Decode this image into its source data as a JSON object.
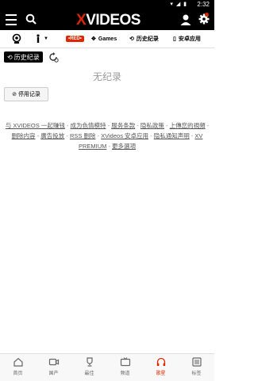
{
  "status": {
    "time": "2:32",
    "icons": "▾ ◢ ▮"
  },
  "header": {
    "logo_x": "X",
    "logo_rest": "VIDEOS"
  },
  "catbar": {
    "red_label": "•RED•",
    "games_label": "Games",
    "history_label": "历史纪录",
    "android_label": "安卓应用"
  },
  "main": {
    "history_button": "历史纪录",
    "empty_text": "无纪录",
    "disable_button": "停用记录"
  },
  "footer": {
    "links": [
      "与 XVIDEOS 一起赚钱",
      "成为色情模特",
      "服务条款",
      "隐私政策",
      "上傳您的視頻",
      "删除内容",
      "廣告投放",
      "RSS 删除",
      "XVideos 安卓应用",
      "隐私通知声明",
      "XV PREMIUM",
      "更多選項"
    ]
  },
  "tabs": [
    {
      "label": "首页"
    },
    {
      "label": "国产"
    },
    {
      "label": "最佳"
    },
    {
      "label": "频道"
    },
    {
      "label": "歌星"
    },
    {
      "label": "标签"
    }
  ],
  "colors": {
    "accent": "#de2600",
    "header_bg": "#000000"
  }
}
